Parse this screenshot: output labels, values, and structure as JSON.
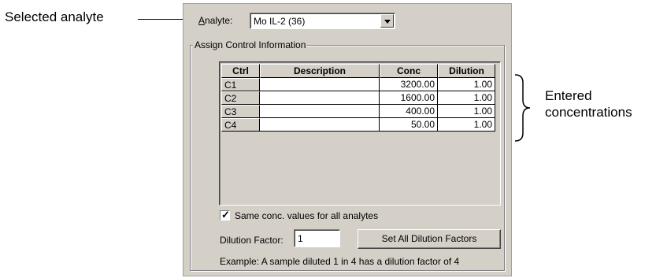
{
  "callouts": {
    "selected_analyte": "Selected analyte",
    "entered_line1": "Entered",
    "entered_line2": "concentrations"
  },
  "analyte": {
    "label_prefix": "A",
    "label_rest": "nalyte:",
    "value": "Mo IL-2 (36)"
  },
  "group": {
    "title": "Assign Control Information"
  },
  "grid": {
    "headers": [
      "Ctrl",
      "Description",
      "Conc",
      "Dilution"
    ],
    "rows": [
      {
        "ctrl": "C1",
        "description": "",
        "conc": "3200.00",
        "dilution": "1.00"
      },
      {
        "ctrl": "C2",
        "description": "",
        "conc": "1600.00",
        "dilution": "1.00"
      },
      {
        "ctrl": "C3",
        "description": "",
        "conc": "400.00",
        "dilution": "1.00"
      },
      {
        "ctrl": "C4",
        "description": "",
        "conc": "50.00",
        "dilution": "1.00"
      }
    ]
  },
  "same_conc": {
    "label": "Same conc. values for all analytes",
    "checked": true
  },
  "dilution": {
    "label": "Dilution Factor:",
    "value": "1",
    "button_label": "Set All Dilution Factors"
  },
  "example_text": "Example: A sample diluted 1 in 4 has a dilution factor of 4"
}
